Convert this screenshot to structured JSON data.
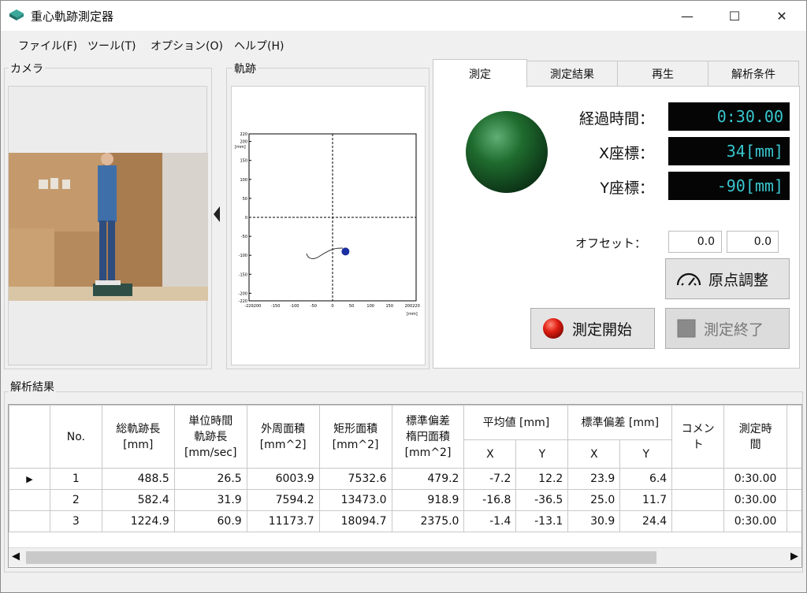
{
  "window": {
    "title": "重心軌跡測定器",
    "minimize": "—",
    "maximize": "☐",
    "close": "✕"
  },
  "menu": [
    {
      "label": "ファイル(F)"
    },
    {
      "label": "ツール(T)"
    },
    {
      "label": "オプション(O)"
    },
    {
      "label": "ヘルプ(H)"
    }
  ],
  "camera": {
    "label": "カメラ"
  },
  "trace": {
    "label": "軌跡",
    "axis_unit": "[mm]",
    "x_ticks": [
      "-220",
      "-200",
      "-150",
      "-100",
      "-50",
      "0",
      "50",
      "100",
      "150",
      "200",
      "220"
    ],
    "y_ticks": [
      "220",
      "200",
      "150",
      "100",
      "50",
      "0",
      "-50",
      "-100",
      "-150",
      "-200",
      "-220"
    ],
    "marker": {
      "x_mm": 34,
      "y_mm": -90
    }
  },
  "tabs": [
    {
      "label": "測定",
      "active": true
    },
    {
      "label": "測定結果",
      "active": false
    },
    {
      "label": "再生",
      "active": false
    },
    {
      "label": "解析条件",
      "active": false
    }
  ],
  "measurement": {
    "elapsed_label": "経過時間：",
    "elapsed_value": "0:30.00",
    "x_label": "X座標：",
    "x_value": "34[mm]",
    "y_label": "Y座標：",
    "y_value": "-90[mm]",
    "offset_label": "オフセット：",
    "offset_x": "0.0",
    "offset_y": "0.0",
    "origin_button": "原点調整",
    "start_button": "測定開始",
    "stop_button": "測定終了",
    "indicator_color": "#1f6b2e"
  },
  "results": {
    "label": "解析結果",
    "headers": {
      "no": "No.",
      "total_len": [
        "総軌跡長",
        "[mm]"
      ],
      "unit_len": [
        "単位時間",
        "軌跡長",
        "[mm/sec]"
      ],
      "outer_area": [
        "外周面積",
        "[mm^2]"
      ],
      "rect_area": [
        "矩形面積",
        "[mm^2]"
      ],
      "ellipse_area": [
        "標準偏差",
        "楕円面積",
        "[mm^2]"
      ],
      "mean": "平均値 [mm]",
      "std": "標準偏差 [mm]",
      "x": "X",
      "y": "Y",
      "comment": [
        "コメン",
        "ト"
      ],
      "time": [
        "測定時",
        "間"
      ]
    },
    "rows": [
      {
        "no": "1",
        "total_len": "488.5",
        "unit_len": "26.5",
        "outer_area": "6003.9",
        "rect_area": "7532.6",
        "ellipse_area": "479.2",
        "mean_x": "-7.2",
        "mean_y": "12.2",
        "std_x": "23.9",
        "std_y": "6.4",
        "comment": "",
        "time": "0:30.00"
      },
      {
        "no": "2",
        "total_len": "582.4",
        "unit_len": "31.9",
        "outer_area": "7594.2",
        "rect_area": "13473.0",
        "ellipse_area": "918.9",
        "mean_x": "-16.8",
        "mean_y": "-36.5",
        "std_x": "25.0",
        "std_y": "11.7",
        "comment": "",
        "time": "0:30.00"
      },
      {
        "no": "3",
        "total_len": "1224.9",
        "unit_len": "60.9",
        "outer_area": "11173.7",
        "rect_area": "18094.7",
        "ellipse_area": "2375.0",
        "mean_x": "-1.4",
        "mean_y": "-13.1",
        "std_x": "30.9",
        "std_y": "24.4",
        "comment": "",
        "time": "0:30.00"
      }
    ]
  }
}
